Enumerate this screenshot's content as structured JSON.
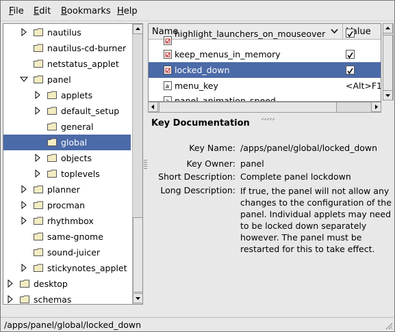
{
  "menubar": {
    "file": {
      "label": "File",
      "u": "F",
      "rest": "ile"
    },
    "edit": {
      "label": "Edit",
      "u": "E",
      "rest": "dit"
    },
    "bookmarks": {
      "label": "Bookmarks",
      "u": "B",
      "rest": "ookmarks"
    },
    "help": {
      "label": "Help",
      "u": "H",
      "rest": "elp"
    }
  },
  "tree": {
    "items": [
      {
        "label": "nautilus",
        "expander": "right",
        "indent": 2
      },
      {
        "label": "nautilus-cd-burner",
        "expander": "none",
        "indent": 2
      },
      {
        "label": "netstatus_applet",
        "expander": "none",
        "indent": 2
      },
      {
        "label": "panel",
        "expander": "down",
        "indent": 2
      },
      {
        "label": "applets",
        "expander": "right",
        "indent": 3
      },
      {
        "label": "default_setup",
        "expander": "right",
        "indent": 3
      },
      {
        "label": "general",
        "expander": "none",
        "indent": 3
      },
      {
        "label": "global",
        "expander": "none",
        "indent": 3,
        "selected": true
      },
      {
        "label": "objects",
        "expander": "right",
        "indent": 3
      },
      {
        "label": "toplevels",
        "expander": "right",
        "indent": 3
      },
      {
        "label": "planner",
        "expander": "right",
        "indent": 2
      },
      {
        "label": "procman",
        "expander": "right",
        "indent": 2
      },
      {
        "label": "rhythmbox",
        "expander": "right",
        "indent": 2
      },
      {
        "label": "same-gnome",
        "expander": "none",
        "indent": 2
      },
      {
        "label": "sound-juicer",
        "expander": "none",
        "indent": 2
      },
      {
        "label": "stickynotes_applet",
        "expander": "right",
        "indent": 2
      },
      {
        "label": "desktop",
        "expander": "right",
        "indent": 1
      },
      {
        "label": "schemas",
        "expander": "right",
        "indent": 1
      }
    ]
  },
  "list": {
    "columns": {
      "name": "Name",
      "value": "Value"
    },
    "rows": [
      {
        "name": "highlight_launchers_on_mouseover",
        "type": "bool",
        "value": "",
        "checked": true
      },
      {
        "name": "keep_menus_in_memory",
        "type": "bool",
        "value": "",
        "checked": true
      },
      {
        "name": "locked_down",
        "type": "bool",
        "value": "",
        "checked": true,
        "selected": true
      },
      {
        "name": "menu_key",
        "type": "string",
        "value": "<Alt>F1"
      },
      {
        "name": "panel_animation_speed",
        "type": "string",
        "value": ""
      }
    ]
  },
  "doc": {
    "title": "Key Documentation",
    "key_name_label": "Key Name:",
    "key_name": "/apps/panel/global/locked_down",
    "key_owner_label": "Key Owner:",
    "key_owner": "panel",
    "short_desc_label": "Short Description:",
    "short_desc": "Complete panel lockdown",
    "long_desc_label": "Long Description:",
    "long_desc": "If true, the panel will not allow any changes to the configuration of the panel. Individual applets may need to be locked down separately however. The panel must be restarted for this to take effect."
  },
  "status": {
    "text": "/apps/panel/global/locked_down"
  },
  "colors": {
    "selection": "#4b6aa8",
    "background": "#e8e8e8"
  }
}
